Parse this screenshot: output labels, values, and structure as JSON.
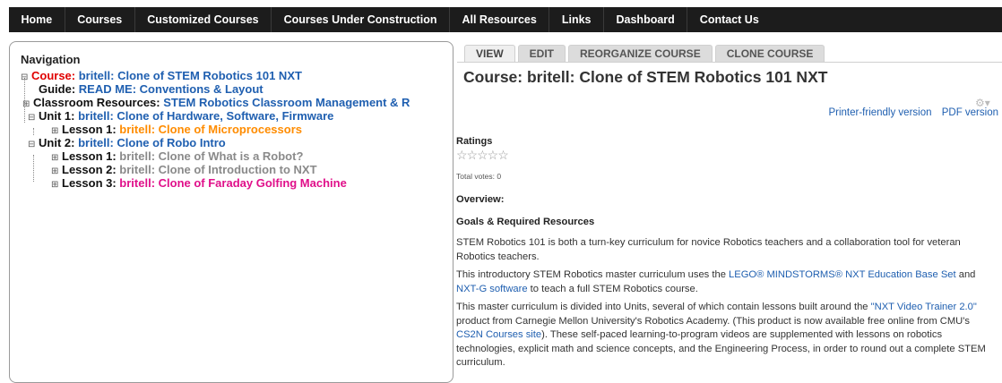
{
  "topnav": {
    "items": [
      "Home",
      "Courses",
      "Customized Courses",
      "Courses Under Construction",
      "All Resources",
      "Links",
      "Dashboard",
      "Contact Us"
    ]
  },
  "navigation": {
    "title": "Navigation",
    "nodes": [
      {
        "prefix": "Course: ",
        "title": "britell: Clone of STEM Robotics 101 NXT",
        "toggle": "⊟"
      },
      {
        "prefix": "Guide: ",
        "title": "READ ME: Conventions & Layout",
        "toggle": ""
      },
      {
        "prefix": "Classroom Resources: ",
        "title": "STEM Robotics Classroom Management & R",
        "toggle": "⊞"
      },
      {
        "prefix": "Unit 1: ",
        "title": "britell: Clone of Hardware, Software, Firmware",
        "toggle": "⊟"
      },
      {
        "prefix": "Lesson 1: ",
        "title": "britell: Clone of Microprocessors",
        "toggle": "⊞"
      },
      {
        "prefix": "Unit 2: ",
        "title": "britell: Clone of Robo Intro",
        "toggle": "⊟"
      },
      {
        "prefix": "Lesson 1: ",
        "title": "britell: Clone of What is a Robot?",
        "toggle": "⊞"
      },
      {
        "prefix": "Lesson 2: ",
        "title": "britell: Clone of Introduction to NXT",
        "toggle": "⊞"
      },
      {
        "prefix": "Lesson 3: ",
        "title": "britell: Clone of Faraday Golfing Machine",
        "toggle": "⊞"
      }
    ]
  },
  "tabs": [
    "VIEW",
    "EDIT",
    "REORGANIZE COURSE",
    "CLONE COURSE"
  ],
  "content": {
    "title": "Course: britell: Clone of STEM Robotics 101 NXT",
    "printer_link": "Printer-friendly version",
    "pdf_link": "PDF version",
    "ratings_label": "Ratings",
    "stars": "☆☆☆☆☆",
    "votes": "Total votes: 0",
    "overview": "Overview:",
    "goals": "Goals & Required Resources",
    "p1": "STEM Robotics 101 is both a turn-key curriculum for novice Robotics teachers and a collaboration tool for veteran Robotics teachers.",
    "p2_a": "This introductory STEM Robotics master curriculum uses the ",
    "p2_link1": "LEGO® MINDSTORMS® NXT Education Base Set",
    "p2_b": " and ",
    "p2_link2": "NXT-G software",
    "p2_c": " to teach a full STEM Robotics course.",
    "p3_a": "This master curriculum is divided into Units, several of which contain lessons built around the ",
    "p3_link1": "\"NXT Video Trainer 2.0\"",
    "p3_b": " product from Carnegie Mellon University's Robotics Academy. (This product is now available free online from CMU's ",
    "p3_link2": "CS2N Courses site",
    "p3_c": "). These self-paced learning-to-program videos are supplemented with lessons on robotics technologies, explicit math and science concepts, and the Engineering Process, in order to round out a complete STEM curriculum."
  }
}
